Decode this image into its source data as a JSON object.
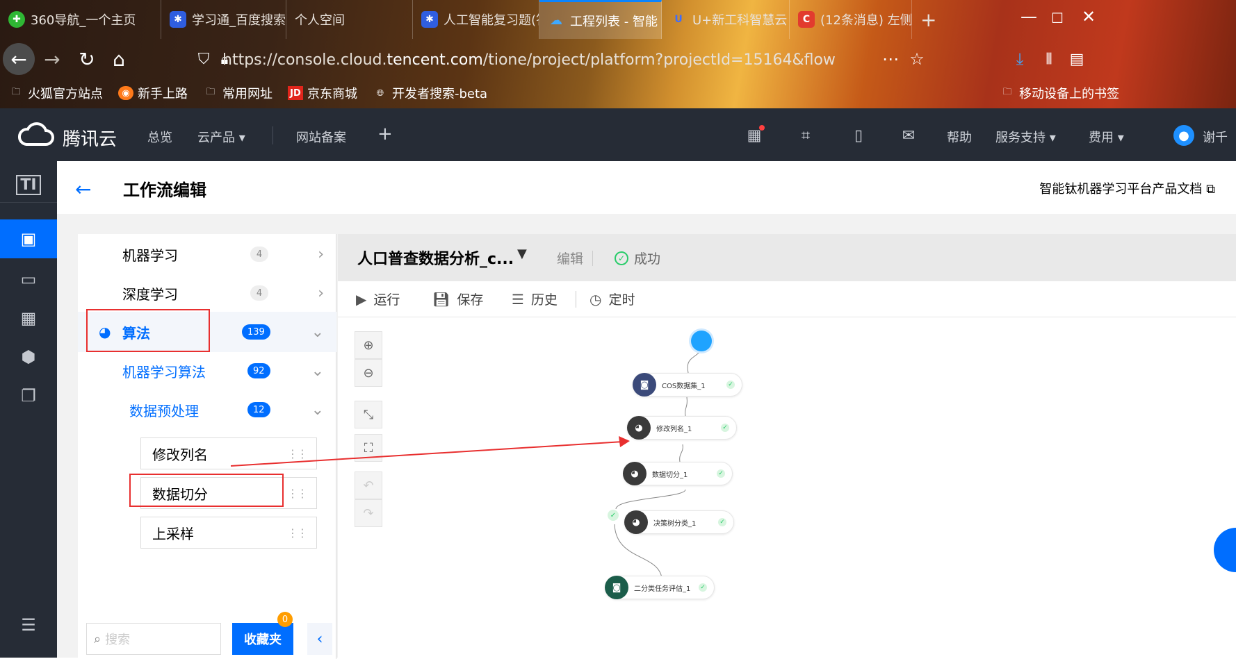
{
  "browser": {
    "tabs": [
      {
        "label": "360导航_一个主页",
        "icon": "360-icon"
      },
      {
        "label": "学习通_百度搜索",
        "icon": "baidu-icon"
      },
      {
        "label": "个人空间",
        "icon": ""
      },
      {
        "label": "人工智能复习题(答",
        "icon": "baidu-icon"
      },
      {
        "label": "工程列表 - 智能",
        "icon": "tencent-cloud-icon",
        "active": true
      },
      {
        "label": "U+新工科智慧云",
        "icon": "u-icon"
      },
      {
        "label": "(12条消息) 左侧",
        "icon": "csdn-icon"
      }
    ],
    "new_tab": "+",
    "url_prefix": "https://console.cloud.",
    "url_domain": "tencent.com",
    "url_path": "/tione/project/platform?projectId=15164&flow",
    "bookmarks": [
      "火狐官方站点",
      "新手上路",
      "常用网址",
      "京东商城",
      "开发者搜索-beta"
    ],
    "mobile_bookmarks": "移动设备上的书签"
  },
  "header": {
    "brand": "腾讯云",
    "nav": [
      "总览",
      "云产品 ▾",
      "网站备案"
    ],
    "help": "帮助",
    "support": "服务支持 ▾",
    "billing": "费用 ▾",
    "user": "谢千"
  },
  "page": {
    "title": "工作流编辑",
    "doc_link": "智能钛机器学习平台产品文档"
  },
  "panel": {
    "categories": [
      {
        "label": "机器学习",
        "count": "4"
      },
      {
        "label": "深度学习",
        "count": "4"
      },
      {
        "label": "算法",
        "count": "139"
      },
      {
        "label": "机器学习算法",
        "count": "92"
      },
      {
        "label": "数据预处理",
        "count": "12"
      }
    ],
    "items": [
      "修改列名",
      "数据切分",
      "上采样"
    ],
    "search_placeholder": "搜索",
    "favorites_label": "收藏夹",
    "favorites_count": "0"
  },
  "flow": {
    "name": "人口普查数据分析_c...",
    "edit": "编辑",
    "status": "成功",
    "tools": [
      "运行",
      "保存",
      "历史",
      "定时"
    ],
    "nodes": [
      "COS数据集_1",
      "修改列名_1",
      "数据切分_1",
      "决策树分类_1",
      "二分类任务评估_1"
    ]
  },
  "colors": {
    "accent": "#006eff",
    "header_bg": "#262c36",
    "success": "#29cc6a",
    "annotation_red": "#e82f2f",
    "start_node": "#1fa3ff"
  }
}
